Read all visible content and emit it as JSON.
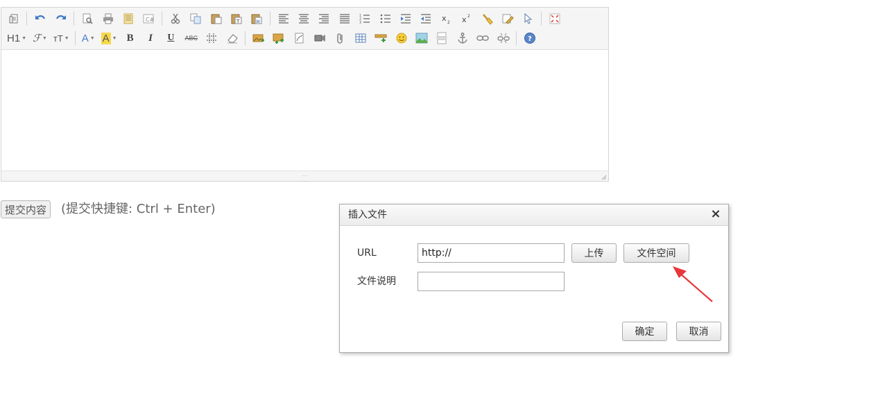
{
  "editor": {
    "toolbar_row1": [
      "source-icon",
      "undo-icon",
      "redo-icon",
      "preview-icon",
      "print-icon",
      "template-icon",
      "insert-code-icon",
      "cut-icon",
      "copy-icon",
      "paste-icon",
      "paste-text-icon",
      "paste-word-icon",
      "align-left-icon",
      "align-center-icon",
      "align-right-icon",
      "align-justify-icon",
      "ordered-list-icon",
      "unordered-list-icon",
      "indent-icon",
      "outdent-icon",
      "subscript-icon",
      "superscript-icon",
      "format-brush-icon",
      "clear-format-icon",
      "select-all-icon",
      "fullscreen-icon"
    ],
    "heading_label": "H1",
    "font_label": "ℱ",
    "size_label": "тT",
    "bold_label": "B",
    "italic_label": "I",
    "underline_label": "U",
    "strike_label": "ABC"
  },
  "submit": {
    "button_label": "提交内容",
    "shortcut_hint": "(提交快捷键: Ctrl + Enter)"
  },
  "dialog": {
    "title": "插入文件",
    "close_glyph": "×",
    "url_label": "URL",
    "url_value": "http://",
    "upload_label": "上传",
    "file_space_label": "文件空间",
    "desc_label": "文件说明",
    "desc_value": "",
    "ok_label": "确定",
    "cancel_label": "取消"
  },
  "colors": {
    "accent_arrow": "#e8363a",
    "toolbar_bg": "#f5f5f5"
  }
}
